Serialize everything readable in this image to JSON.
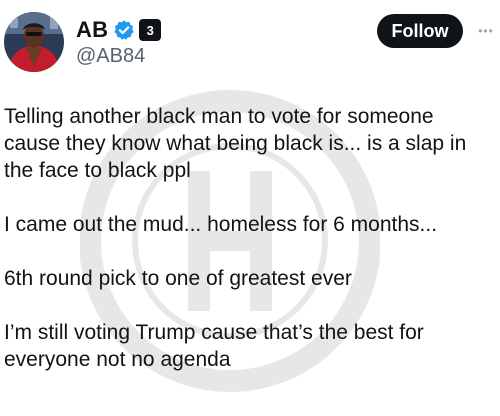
{
  "author": {
    "display_name": "AB",
    "handle": "@AB84",
    "badge_label": "3"
  },
  "actions": {
    "follow_label": "Follow",
    "more_label": "•••"
  },
  "post": {
    "paragraphs": [
      "Telling another black man to vote for someone cause they know what being black is... is a slap in the face to black ppl",
      "I came out the mud...  homeless for 6 months...",
      "6th round pick to one of greatest ever",
      "I’m still voting Trump cause that’s the best for everyone not no agenda"
    ]
  },
  "colors": {
    "text": "#0f1419",
    "secondary_text": "#536471",
    "verified": "#1d9bf0",
    "follow_bg": "#0f1419"
  }
}
